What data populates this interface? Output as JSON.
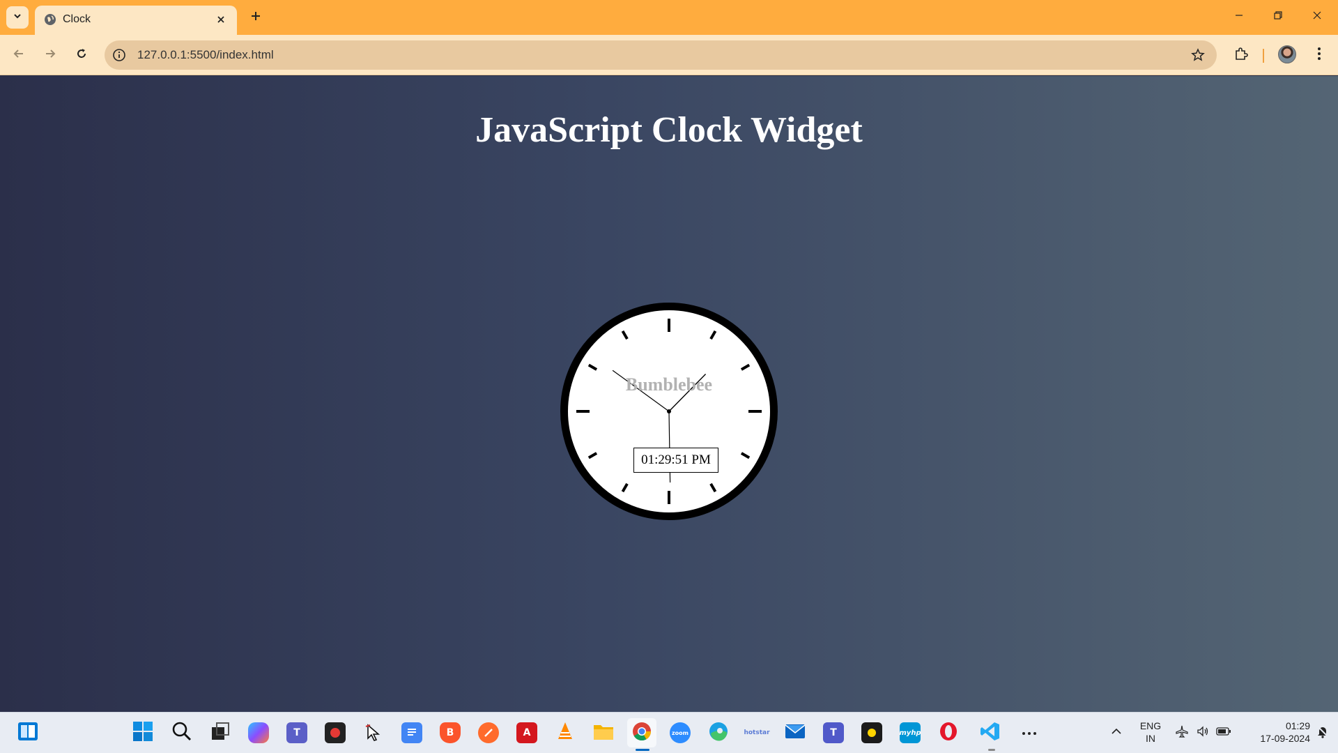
{
  "browser": {
    "tab_title": "Clock",
    "url": "127.0.0.1:5500/index.html"
  },
  "page": {
    "title": "JavaScript Clock Widget",
    "clock": {
      "brand": "Bumblebee",
      "digital_time": "01:29:51 PM",
      "hour": 1,
      "minute": 29,
      "second": 51
    }
  },
  "taskbar": {
    "apps": [
      "Widgets",
      "Start",
      "Search",
      "Task View",
      "Copilot",
      "Microsoft Teams",
      "Screen Recorder",
      "Snipping Tool",
      "Google Docs",
      "Brave",
      "Safari",
      "Adobe Acrobat",
      "VLC",
      "File Explorer",
      "Google Chrome",
      "Zoom",
      "Microsoft Edge",
      "Disney+ Hotstar",
      "Mail",
      "Microsoft Teams (work)",
      "Media Player",
      "myHP",
      "Opera",
      "Visual Studio Code",
      "More"
    ],
    "language": "ENG",
    "region": "IN",
    "time": "01:29",
    "date": "17-09-2024"
  }
}
